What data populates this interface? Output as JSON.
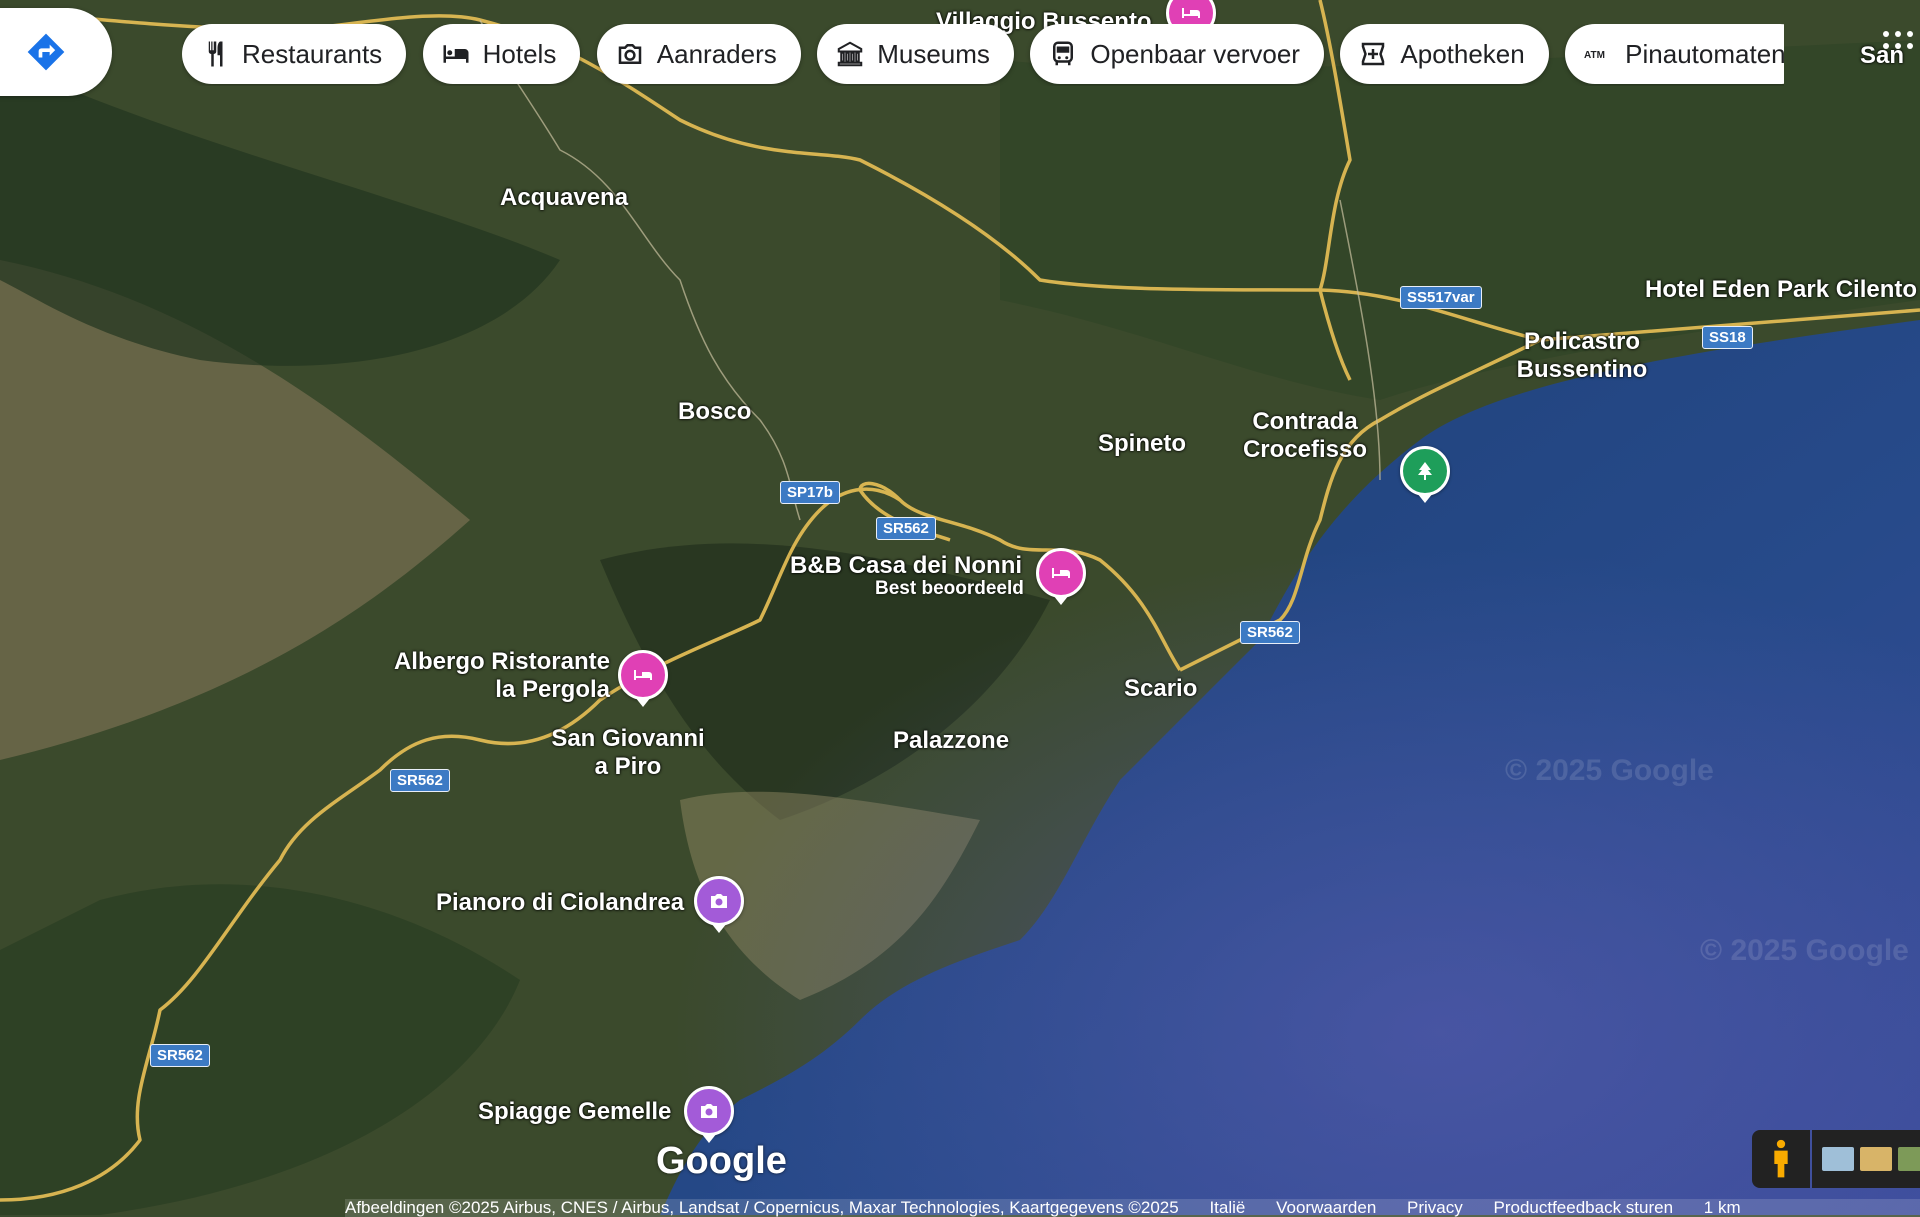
{
  "toolbar": {
    "chips": [
      {
        "label": "Restaurants",
        "icon": "fork-knife-icon"
      },
      {
        "label": "Hotels",
        "icon": "bed-icon"
      },
      {
        "label": "Aanraders",
        "icon": "camera-icon"
      },
      {
        "label": "Museums",
        "icon": "museum-icon"
      },
      {
        "label": "Openbaar vervoer",
        "icon": "bus-icon"
      },
      {
        "label": "Apotheken",
        "icon": "pharmacy-icon"
      },
      {
        "label": "Pinautomaten",
        "icon": "atm-icon"
      }
    ]
  },
  "places": {
    "villaggio": "Villaggio Bussento",
    "acquavena": "Acquavena",
    "bosco": "Bosco",
    "spineto": "Spineto",
    "contrada_1": "Contrada",
    "contrada_2": "Crocefisso",
    "policastro_1": "Policastro",
    "policastro_2": "Bussentino",
    "hotel_eden": "Hotel Eden Park Cilento",
    "bnb": "B&B Casa dei Nonni",
    "bnb_sub": "Best beoordeeld",
    "albergo_1": "Albergo Ristorante",
    "albergo_2": "la Pergola",
    "sangiovanni_1": "San Giovanni",
    "sangiovanni_2": "a Piro",
    "palazzone": "Palazzone",
    "scario": "Scario",
    "pianoro": "Pianoro di Ciolandrea",
    "spiagge": "Spiagge Gemelle",
    "san_edge": "San"
  },
  "roads": {
    "ss517var": "SS517var",
    "ss18": "SS18",
    "sp17b": "SP17b",
    "sr562_a": "SR562",
    "sr562_b": "SR562",
    "sr562_c": "SR562",
    "sr562_d": "SR562"
  },
  "watermark": "© 2025 Google",
  "logo": "Google",
  "footer": {
    "attribution": "Afbeeldingen ©2025 Airbus, CNES / Airbus, Landsat / Copernicus, Maxar Technologies, Kaartgegevens ©2025",
    "country": "Italië",
    "terms": "Voorwaarden",
    "privacy": "Privacy",
    "feedback": "Productfeedback sturen",
    "scale": "1 km"
  },
  "colors": {
    "hotel_pin": "#e040b5",
    "camera_pin": "#a35bd8",
    "park_pin": "#1e9e5a",
    "road": "#d7b451",
    "shield": "#3c7ac4",
    "directions": "#1a73e8"
  }
}
